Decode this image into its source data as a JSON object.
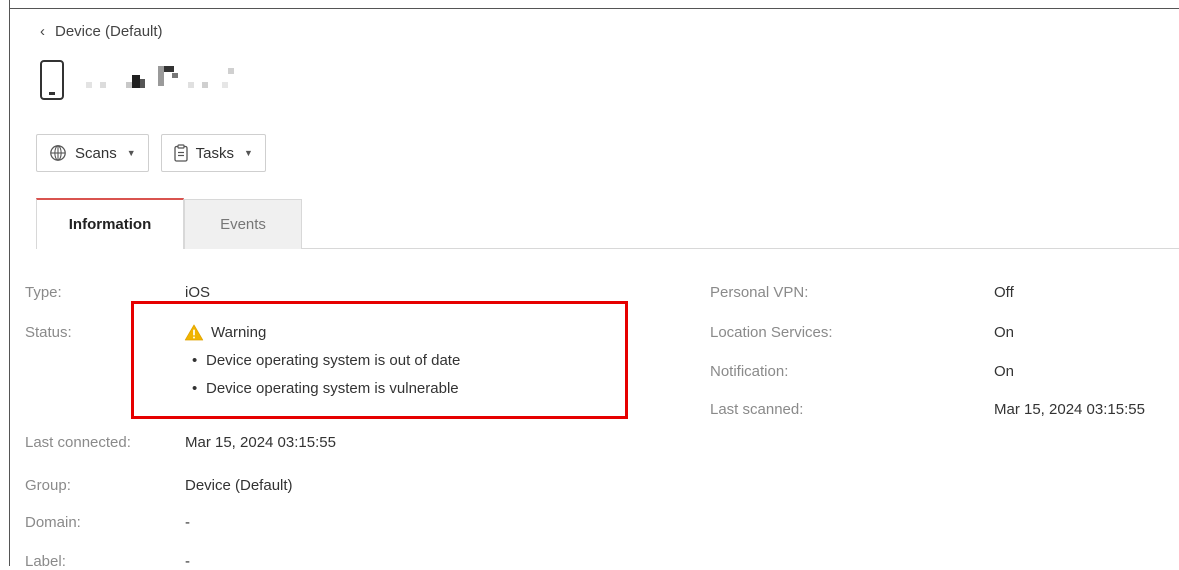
{
  "header": {
    "back_label": "Device (Default)"
  },
  "toolbar": {
    "scans_label": "Scans",
    "tasks_label": "Tasks"
  },
  "tabs": [
    {
      "label": "Information",
      "active": true
    },
    {
      "label": "Events",
      "active": false
    }
  ],
  "info_left": {
    "type_label": "Type:",
    "type_value": "iOS",
    "status_label": "Status:",
    "status_value": "Warning",
    "status_details": [
      "Device operating system is out of date",
      "Device operating system is vulnerable"
    ],
    "last_connected_label": "Last connected:",
    "last_connected_value": "Mar 15, 2024 03:15:55",
    "group_label": "Group:",
    "group_value": "Device (Default)",
    "domain_label": "Domain:",
    "domain_value": "-",
    "label_label": "Label:",
    "label_value": "-"
  },
  "info_right": {
    "vpn_label": "Personal VPN:",
    "vpn_value": "Off",
    "location_label": "Location Services:",
    "location_value": "On",
    "notification_label": "Notification:",
    "notification_value": "On",
    "last_scanned_label": "Last scanned:",
    "last_scanned_value": "Mar 15, 2024 03:15:55"
  },
  "colors": {
    "highlight": "#e60000",
    "active_tab_accent": "#d9534f",
    "warning": "#f0b400"
  }
}
